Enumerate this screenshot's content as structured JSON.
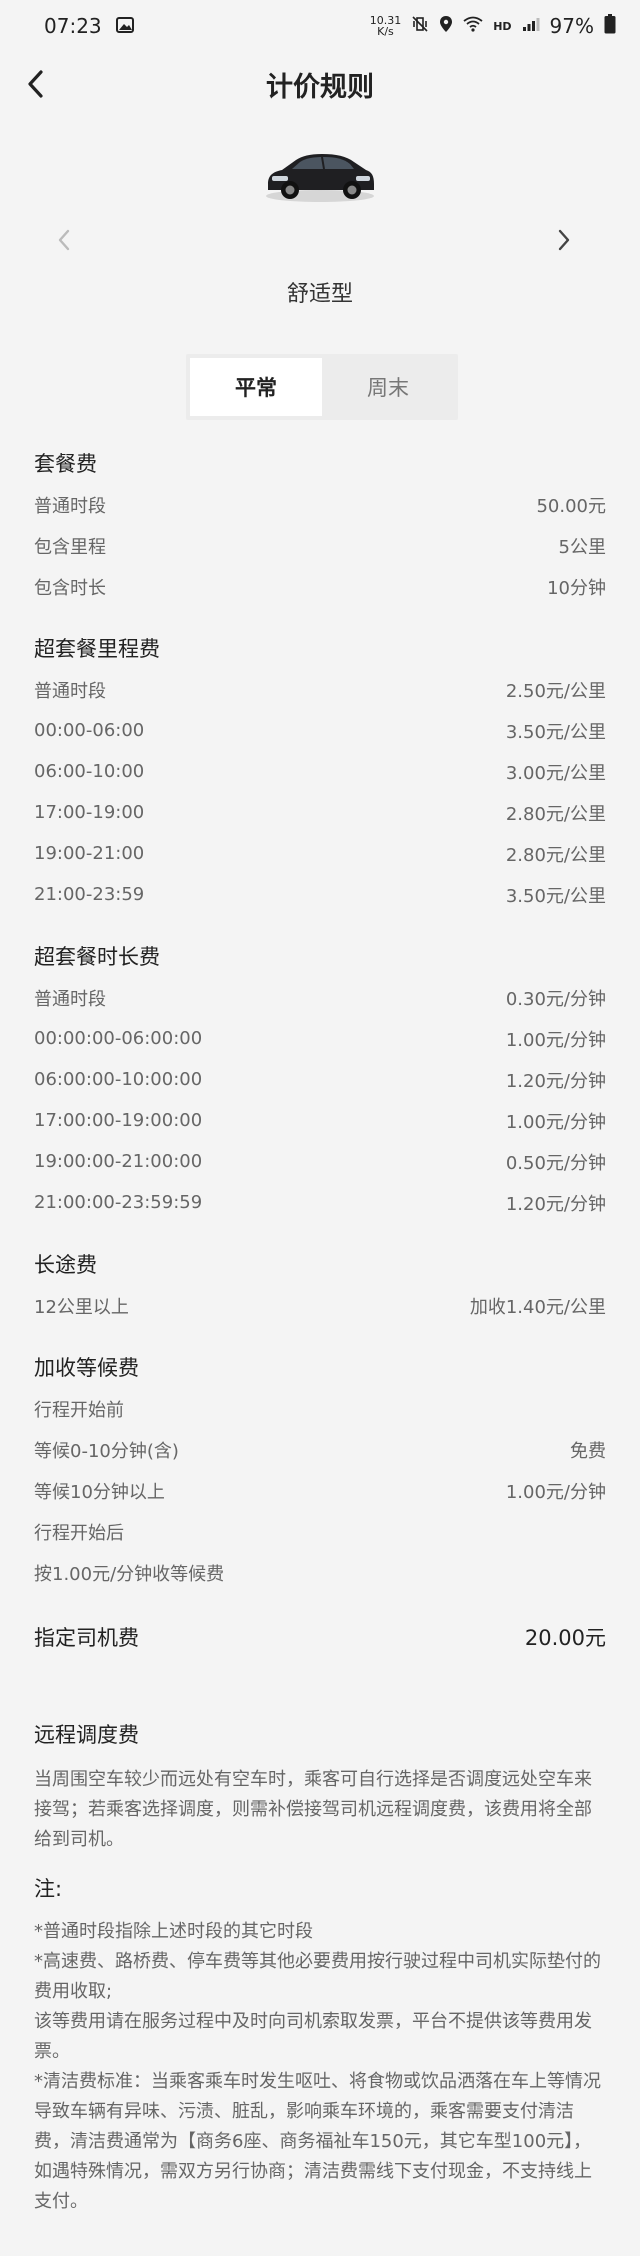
{
  "status": {
    "time": "07:23",
    "net_speed_top": "10.31",
    "net_speed_bottom": "K/s",
    "battery": "97%"
  },
  "header": {
    "title": "计价规则"
  },
  "car": {
    "name": "舒适型"
  },
  "tabs": [
    {
      "label": "平常",
      "active": true
    },
    {
      "label": "周末",
      "active": false
    }
  ],
  "package": {
    "title": "套餐费",
    "rows": [
      {
        "label": "普通时段",
        "value": "50.00元"
      },
      {
        "label": "包含里程",
        "value": "5公里"
      },
      {
        "label": "包含时长",
        "value": "10分钟"
      }
    ]
  },
  "mileage": {
    "title": "超套餐里程费",
    "rows": [
      {
        "label": "普通时段",
        "value": "2.50元/公里"
      },
      {
        "label": "00:00-06:00",
        "value": "3.50元/公里"
      },
      {
        "label": "06:00-10:00",
        "value": "3.00元/公里"
      },
      {
        "label": "17:00-19:00",
        "value": "2.80元/公里"
      },
      {
        "label": "19:00-21:00",
        "value": "2.80元/公里"
      },
      {
        "label": "21:00-23:59",
        "value": "3.50元/公里"
      }
    ]
  },
  "duration": {
    "title": "超套餐时长费",
    "rows": [
      {
        "label": "普通时段",
        "value": "0.30元/分钟"
      },
      {
        "label": "00:00:00-06:00:00",
        "value": "1.00元/分钟"
      },
      {
        "label": "06:00:00-10:00:00",
        "value": "1.20元/分钟"
      },
      {
        "label": "17:00:00-19:00:00",
        "value": "1.00元/分钟"
      },
      {
        "label": "19:00:00-21:00:00",
        "value": "0.50元/分钟"
      },
      {
        "label": "21:00:00-23:59:59",
        "value": "1.20元/分钟"
      }
    ]
  },
  "longdistance": {
    "title": "长途费",
    "rows": [
      {
        "label": "12公里以上",
        "value": "加收1.40元/公里"
      }
    ]
  },
  "waiting": {
    "title": "加收等候费",
    "rows": [
      {
        "label": "行程开始前",
        "value": ""
      },
      {
        "label": "等候0-10分钟(含)",
        "value": "免费"
      },
      {
        "label": "等候10分钟以上",
        "value": "1.00元/分钟"
      },
      {
        "label": "行程开始后",
        "value": ""
      },
      {
        "label": "按1.00元/分钟收等候费",
        "value": ""
      }
    ]
  },
  "driver": {
    "label": "指定司机费",
    "value": "20.00元"
  },
  "remote": {
    "title": "远程调度费",
    "text": "当周围空车较少而远处有空车时，乘客可自行选择是否调度远处空车来接驾；若乘客选择调度，则需补偿接驾司机远程调度费，该费用将全部给到司机。"
  },
  "notes": {
    "title": "注:",
    "lines": [
      "*普通时段指除上述时段的其它时段",
      "*高速费、路桥费、停车费等其他必要费用按行驶过程中司机实际垫付的费用收取;",
      "该等费用请在服务过程中及时向司机索取发票，平台不提供该等费用发票。",
      "*清洁费标准：当乘客乘车时发生呕吐、将食物或饮品洒落在车上等情况导致车辆有异味、污渍、脏乱，影响乘车环境的，乘客需要支付清洁费，清洁费通常为【商务6座、商务福祉车150元，其它车型100元】，如遇特殊情况，需双方另行协商；清洁费需线下支付现金，不支持线上支付。"
    ]
  }
}
